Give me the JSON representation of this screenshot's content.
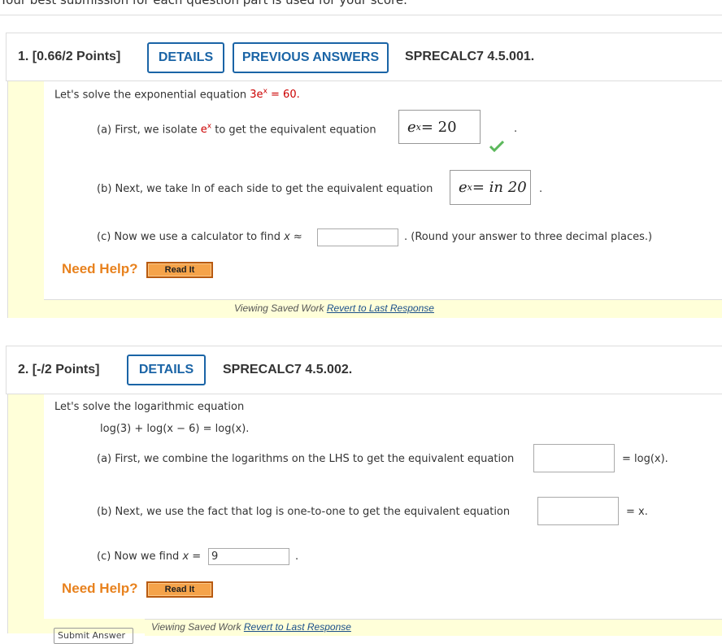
{
  "header_text": "Your best submission for each question part is used for your score.",
  "q1": {
    "number": "1.",
    "points": "[0.66/2 Points]",
    "details_label": "DETAILS",
    "prev_label": "PREVIOUS ANSWERS",
    "code": "SPRECALC7 4.5.001.",
    "intro": "Let's solve the exponential equation",
    "equation": "3e",
    "equation_exp": "x",
    "equation_rhs": "= 60",
    "a_text": "(a) First, we isolate",
    "a_var": "e",
    "a_var_exp": "x",
    "a_text2": "to get the equivalent equation",
    "a_answer_base": "e",
    "a_answer_exp": "x",
    "a_answer_rhs": " = 20",
    "b_text": "(b) Next, we take ln of each side to get the equivalent equation",
    "b_answer_base": "e",
    "b_answer_exp": "x",
    "b_answer_rhs": " = in 20",
    "c_text": "(c) Now we use a calculator to find",
    "c_var": "x ≈",
    "c_value": "",
    "c_note": "(Round your answer to three decimal places.)",
    "need_help": "Need Help?",
    "read_it": "Read It",
    "saved_text": "Viewing Saved Work",
    "revert_text": "Revert to Last Response"
  },
  "q2": {
    "number": "2.",
    "points": "[-/2 Points]",
    "details_label": "DETAILS",
    "code": "SPRECALC7 4.5.002.",
    "intro": "Let's solve the logarithmic equation",
    "equation": "log(3) + log(x − 6) = log(x).",
    "a_text": "(a) First, we combine the logarithms on the LHS to get the equivalent equation",
    "a_value": "",
    "a_suffix": "= log(x).",
    "b_text": "(b) Next, we use the fact that log is one-to-one to get the equivalent equation",
    "b_value": "",
    "b_suffix": "= x.",
    "c_text": "(c) Now we find",
    "c_var": "x =",
    "c_value": "9",
    "need_help": "Need Help?",
    "read_it": "Read It",
    "submit_label": "Submit Answer",
    "saved_text": "Viewing Saved Work",
    "revert_text": "Revert to Last Response"
  },
  "colors": {
    "accent": "#1a64a6",
    "help": "#e8821e",
    "panel": "#ffffd9",
    "correct": "#5cb85c"
  }
}
